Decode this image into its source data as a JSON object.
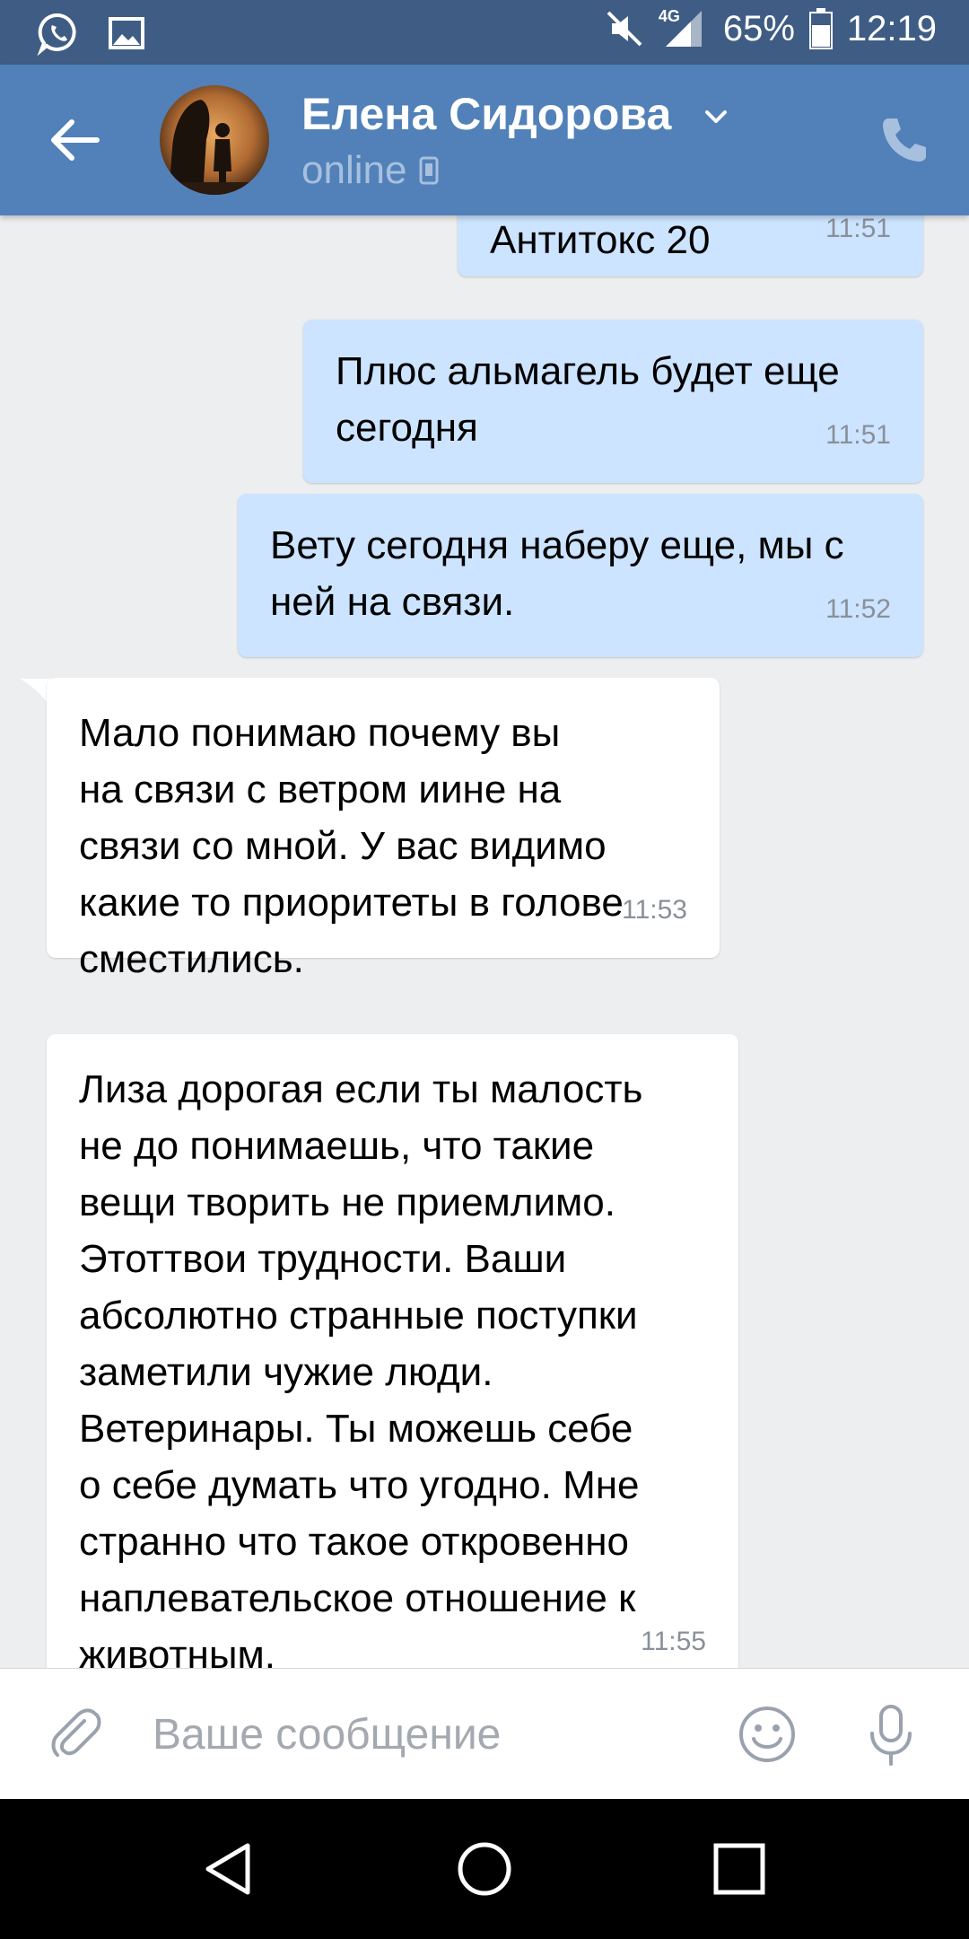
{
  "status_bar": {
    "network": "4G",
    "battery": "65%",
    "time": "12:19",
    "icons": [
      "whatsapp-icon",
      "image-icon",
      "muted-icon",
      "signal-icon",
      "battery-icon"
    ]
  },
  "header": {
    "contact_name": "Елена Сидорова",
    "presence": "online",
    "icons": [
      "back-arrow-icon",
      "chevron-down-icon",
      "phone-icon",
      "mobile-icon"
    ]
  },
  "messages": [
    {
      "direction": "outgoing",
      "text": "Антитокс 20",
      "time": "11:51"
    },
    {
      "direction": "outgoing",
      "text": "Плюс альмагель будет еще\nсегодня",
      "time": "11:51"
    },
    {
      "direction": "outgoing",
      "text": "Вету сегодня наберу еще, мы с\nней на связи.",
      "time": "11:52"
    },
    {
      "direction": "incoming",
      "text": "Мало понимаю почему вы\nна связи с ветром иине на\nсвязи со мной. У вас видимо\nкакие то приоритеты в голове\nсместились.",
      "time": "11:53"
    },
    {
      "direction": "incoming",
      "text": "Лиза дорогая если ты малость\nне до понимаешь, что такие\nвещи творить не приемлимо.\nЭтоттвои трудности. Ваши\nабсолютно странные поступки\nзаметили чужие люди.\nВетеринары. Ты можешь себе\nо себе думать что угодно. Мне\nстранно что такое откровенно\nнаплевательское отношение к\nживотным.",
      "time": "11:55"
    }
  ],
  "composer": {
    "placeholder": "Ваше сообщение",
    "value": "",
    "icons": [
      "paperclip-icon",
      "emoji-icon",
      "microphone-icon"
    ]
  },
  "navigation_bar": {
    "icons": [
      "nav-back-icon",
      "nav-home-icon",
      "nav-recents-icon"
    ]
  },
  "colors": {
    "header": "#5181b8",
    "status_bar": "#3f5d84",
    "outgoing_bubble": "#cce4ff",
    "incoming_bubble": "#ffffff",
    "background": "#edeef0",
    "presence": "#a7c0de"
  }
}
